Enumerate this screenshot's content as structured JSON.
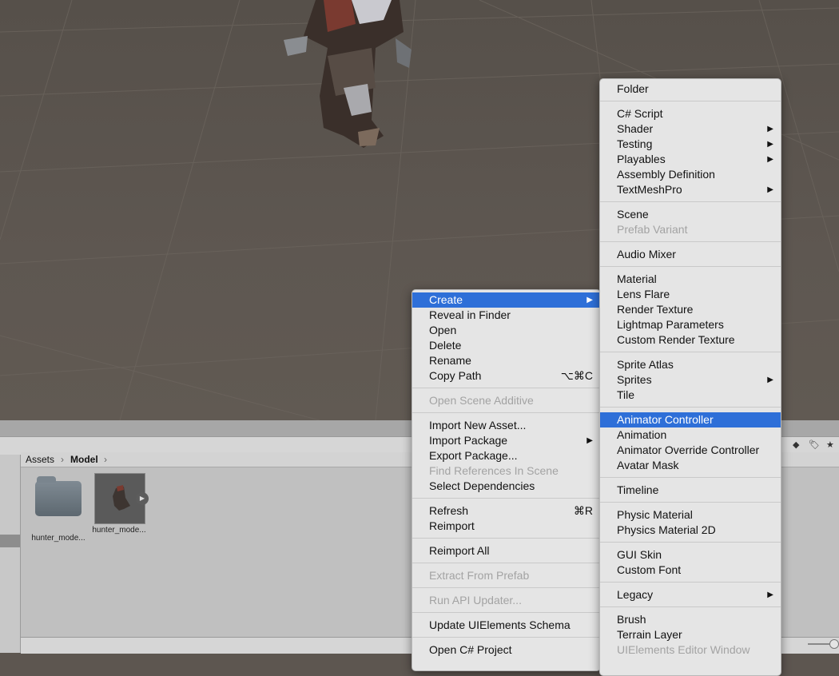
{
  "breadcrumb": {
    "root": "Assets",
    "current": "Model"
  },
  "assets": [
    {
      "label": "hunter_mode...",
      "kind": "folder"
    },
    {
      "label": "hunter_mode...",
      "kind": "model"
    }
  ],
  "context_menu": {
    "items": [
      {
        "label": "Create",
        "highlighted": true,
        "submenu": true
      },
      {
        "label": "Reveal in Finder"
      },
      {
        "label": "Open"
      },
      {
        "label": "Delete"
      },
      {
        "label": "Rename"
      },
      {
        "label": "Copy Path",
        "shortcut": "⌥⌘C"
      },
      {
        "label": "Open Scene Additive",
        "disabled": true
      },
      {
        "label": "Import New Asset..."
      },
      {
        "label": "Import Package",
        "submenu": true
      },
      {
        "label": "Export Package..."
      },
      {
        "label": "Find References In Scene",
        "disabled": true
      },
      {
        "label": "Select Dependencies"
      },
      {
        "label": "Refresh",
        "shortcut": "⌘R"
      },
      {
        "label": "Reimport"
      },
      {
        "label": "Reimport All"
      },
      {
        "label": "Extract From Prefab",
        "disabled": true
      },
      {
        "label": "Run API Updater...",
        "disabled": true
      },
      {
        "label": "Update UIElements Schema"
      },
      {
        "label": "Open C# Project"
      }
    ]
  },
  "create_submenu": {
    "items": [
      {
        "label": "Folder"
      },
      {
        "label": "C# Script"
      },
      {
        "label": "Shader",
        "submenu": true
      },
      {
        "label": "Testing",
        "submenu": true
      },
      {
        "label": "Playables",
        "submenu": true
      },
      {
        "label": "Assembly Definition"
      },
      {
        "label": "TextMeshPro",
        "submenu": true
      },
      {
        "label": "Scene"
      },
      {
        "label": "Prefab Variant",
        "disabled": true
      },
      {
        "label": "Audio Mixer"
      },
      {
        "label": "Material"
      },
      {
        "label": "Lens Flare"
      },
      {
        "label": "Render Texture"
      },
      {
        "label": "Lightmap Parameters"
      },
      {
        "label": "Custom Render Texture"
      },
      {
        "label": "Sprite Atlas"
      },
      {
        "label": "Sprites",
        "submenu": true
      },
      {
        "label": "Tile"
      },
      {
        "label": "Animator Controller",
        "highlighted": true
      },
      {
        "label": "Animation"
      },
      {
        "label": "Animator Override Controller"
      },
      {
        "label": "Avatar Mask"
      },
      {
        "label": "Timeline"
      },
      {
        "label": "Physic Material"
      },
      {
        "label": "Physics Material 2D"
      },
      {
        "label": "GUI Skin"
      },
      {
        "label": "Custom Font"
      },
      {
        "label": "Legacy",
        "submenu": true
      },
      {
        "label": "Brush"
      },
      {
        "label": "Terrain Layer"
      },
      {
        "label": "UIElements Editor Window",
        "disabled": true
      }
    ]
  },
  "colors": {
    "highlight": "#2e6fd8",
    "menu_bg": "#e5e5e5",
    "scene_bg": "#5d5650"
  }
}
